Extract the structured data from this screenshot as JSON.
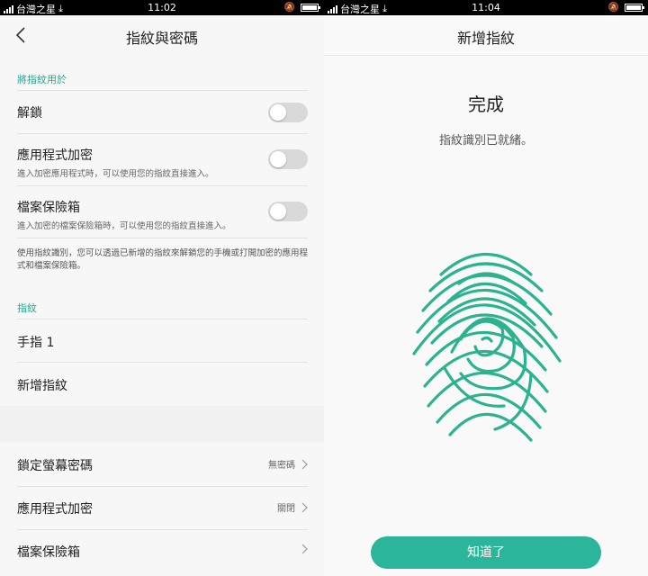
{
  "status_left": {
    "carrier": "台灣之星",
    "time": "11:02"
  },
  "status_right": {
    "carrier": "台灣之星",
    "time": "11:04"
  },
  "settings_screen": {
    "title": "指紋與密碼",
    "section_use": "將指紋用於",
    "unlock": {
      "label": "解鎖",
      "enabled": false
    },
    "app_lock": {
      "label": "應用程式加密",
      "sub": "進入加密應用程式時，可以使用您的指紋直接進入。",
      "enabled": false
    },
    "file_safe": {
      "label": "檔案保險箱",
      "sub": "進入加密的檔案保險箱時，可以使用您的指紋直接進入。",
      "enabled": false
    },
    "description": "使用指紋識別，您可以透過已新增的指紋來解鎖您的手機或打開加密的應用程式和檔案保險箱。",
    "section_fingerprints": "指紋",
    "finger_1": "手指 1",
    "add_fingerprint": "新增指紋",
    "screen_lock": {
      "label": "鎖定螢幕密碼",
      "value": "無密碼"
    },
    "app_encrypt": {
      "label": "應用程式加密",
      "value": "關閉"
    },
    "file_vault": {
      "label": "檔案保險箱"
    }
  },
  "enroll_screen": {
    "title": "新增指紋",
    "done": "完成",
    "ready": "指紋識別已就緒。",
    "ok_button": "知道了"
  },
  "colors": {
    "accent": "#2aa58a",
    "fingerprint": "#2bb28f",
    "button": "#2bb59b"
  }
}
